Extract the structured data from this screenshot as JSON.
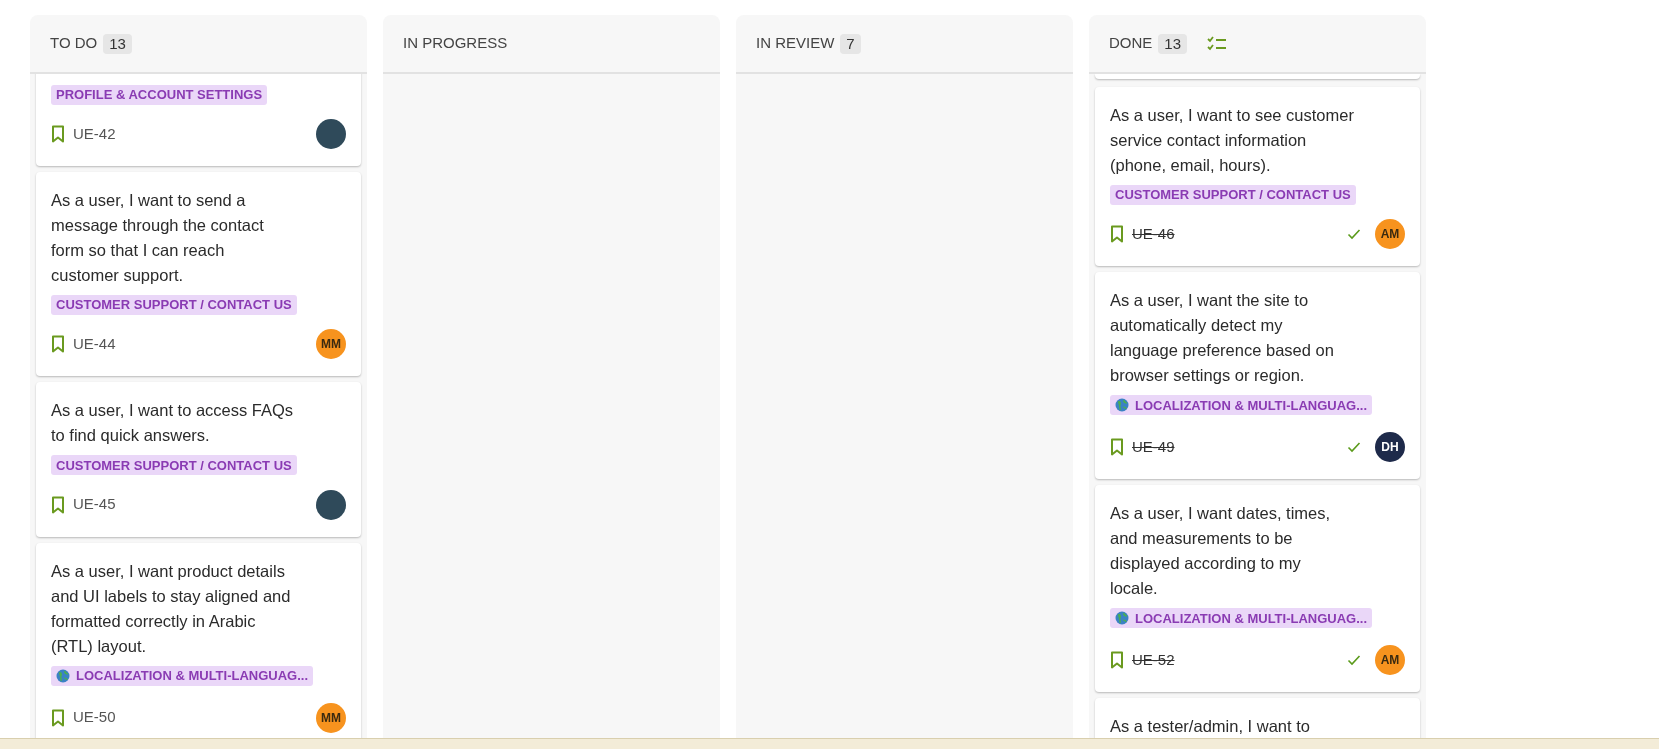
{
  "columns": [
    {
      "title": "TO DO",
      "count": "13",
      "cards": [
        {
          "tag": {
            "label": "PROFILE & ACCOUNT SETTINGS",
            "kind": "plain"
          },
          "key": "UE-42",
          "done": false,
          "avatar": {
            "kind": "photo"
          }
        },
        {
          "text": "As a user, I want to send a\nmessage through the contact\nform so that I can reach\ncustomer support.",
          "tag": {
            "label": "CUSTOMER SUPPORT / CONTACT US",
            "kind": "plain"
          },
          "key": "UE-44",
          "done": false,
          "avatar": {
            "kind": "initials",
            "initials": "MM",
            "color": "#f7931e"
          }
        },
        {
          "text": "As a user, I want to access FAQs\nto find quick answers.",
          "tag": {
            "label": "CUSTOMER SUPPORT / CONTACT US",
            "kind": "plain"
          },
          "key": "UE-45",
          "done": false,
          "avatar": {
            "kind": "photo"
          }
        },
        {
          "text": "As a user, I want product details\nand UI labels to stay aligned and\nformatted correctly in Arabic\n(RTL) layout.",
          "tag": {
            "label": "LOCALIZATION & MULTI-LANGUAG...",
            "kind": "globe"
          },
          "key": "UE-50",
          "done": false,
          "avatar": {
            "kind": "initials",
            "initials": "MM",
            "color": "#f7931e"
          }
        }
      ]
    },
    {
      "title": "IN PROGRESS"
    },
    {
      "title": "IN REVIEW",
      "count": "7"
    },
    {
      "title": "DONE",
      "count": "13",
      "checklist": true,
      "top_stub": true,
      "cards": [
        {
          "text": "As a user, I want to see customer\nservice contact information\n(phone, email, hours).",
          "tag": {
            "label": "CUSTOMER SUPPORT / CONTACT US",
            "kind": "plain"
          },
          "key": "UE-46",
          "done": true,
          "avatar": {
            "kind": "initials",
            "initials": "AM",
            "color": "#f7931e"
          }
        },
        {
          "text": "As a user, I want the site to\nautomatically detect my\nlanguage preference based on\nbrowser settings or region.",
          "tag": {
            "label": "LOCALIZATION & MULTI-LANGUAG...",
            "kind": "globe"
          },
          "key": "UE-49",
          "done": true,
          "avatar": {
            "kind": "initials",
            "initials": "DH",
            "color": "#1e2a4a"
          }
        },
        {
          "text": "As a user, I want dates, times,\nand measurements to be\ndisplayed according to my\nlocale.",
          "tag": {
            "label": "LOCALIZATION & MULTI-LANGUAG...",
            "kind": "globe"
          },
          "key": "UE-52",
          "done": true,
          "avatar": {
            "kind": "initials",
            "initials": "AM",
            "color": "#f7931e"
          }
        },
        {
          "text": "As a tester/admin, I want to"
        }
      ]
    }
  ]
}
